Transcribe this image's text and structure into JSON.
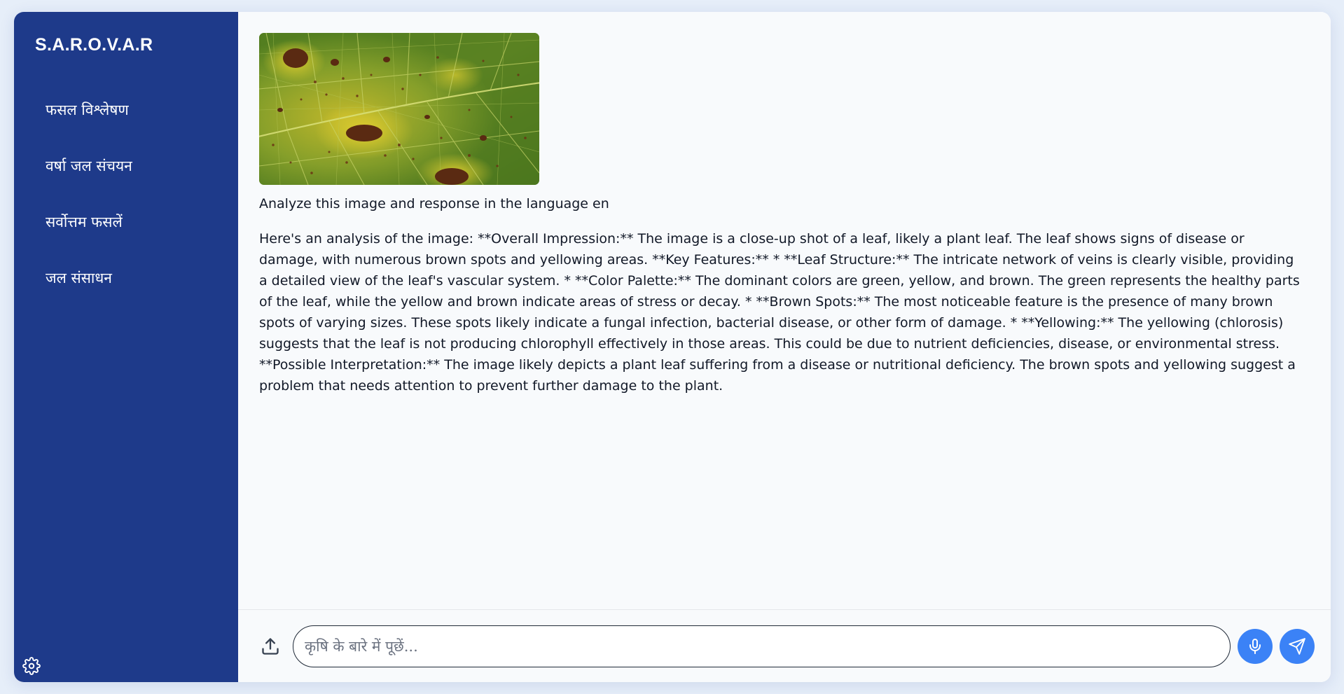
{
  "app": {
    "brand": "S.A.R.O.V.A.R"
  },
  "sidebar": {
    "items": [
      {
        "label": "फसल विश्लेषण"
      },
      {
        "label": "वर्षा जल संचयन"
      },
      {
        "label": "सर्वोत्तम फसलें"
      },
      {
        "label": "जल संसाधन"
      }
    ],
    "settings_icon": "gear-icon"
  },
  "chat": {
    "user_message": "Analyze this image and response in the language en",
    "assistant_message": "Here's an analysis of the image: **Overall Impression:** The image is a close-up shot of a leaf, likely a plant leaf. The leaf shows signs of disease or damage, with numerous brown spots and yellowing areas. **Key Features:** * **Leaf Structure:** The intricate network of veins is clearly visible, providing a detailed view of the leaf's vascular system. * **Color Palette:** The dominant colors are green, yellow, and brown. The green represents the healthy parts of the leaf, while the yellow and brown indicate areas of stress or decay. * **Brown Spots:** The most noticeable feature is the presence of many brown spots of varying sizes. These spots likely indicate a fungal infection, bacterial disease, or other form of damage. * **Yellowing:** The yellowing (chlorosis) suggests that the leaf is not producing chlorophyll effectively in those areas. This could be due to nutrient deficiencies, disease, or environmental stress. **Possible Interpretation:** The image likely depicts a plant leaf suffering from a disease or nutritional deficiency. The brown spots and yellowing suggest a problem that needs attention to prevent further damage to the plant."
  },
  "composer": {
    "placeholder": "कृषि के बारे में पूछें...",
    "value": "",
    "upload_icon": "upload-icon",
    "mic_icon": "microphone-icon",
    "send_icon": "send-icon"
  },
  "colors": {
    "sidebar_bg": "#1e3a8a",
    "accent": "#3b82f6",
    "page_bg": "#f8fafc"
  }
}
